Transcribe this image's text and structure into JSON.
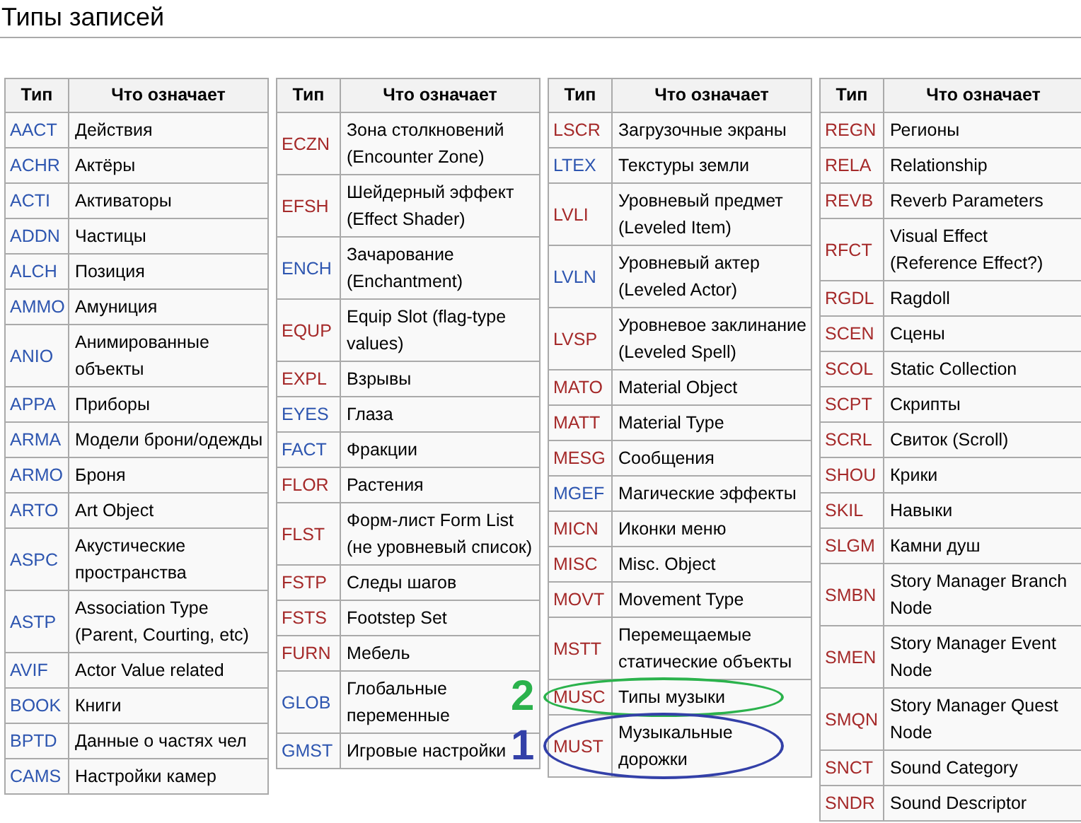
{
  "title": "Типы записей",
  "tables": [
    {
      "columns": [
        "Тип",
        "Что означает"
      ],
      "rows": [
        {
          "code": "AACT",
          "missing": false,
          "meaning": "Действия"
        },
        {
          "code": "ACHR",
          "missing": false,
          "meaning": "Актёры"
        },
        {
          "code": "ACTI",
          "missing": false,
          "meaning": "Активаторы"
        },
        {
          "code": "ADDN",
          "missing": false,
          "meaning": "Частицы"
        },
        {
          "code": "ALCH",
          "missing": false,
          "meaning": "Позиция"
        },
        {
          "code": "AMMO",
          "missing": false,
          "meaning": "Амуниция"
        },
        {
          "code": "ANIO",
          "missing": false,
          "meaning": "Анимированные объекты"
        },
        {
          "code": "APPA",
          "missing": false,
          "meaning": "Приборы"
        },
        {
          "code": "ARMA",
          "missing": false,
          "meaning": "Модели брони/одежды"
        },
        {
          "code": "ARMO",
          "missing": false,
          "meaning": "Броня"
        },
        {
          "code": "ARTO",
          "missing": false,
          "meaning": "Art Object"
        },
        {
          "code": "ASPC",
          "missing": false,
          "meaning": "Акустические пространства"
        },
        {
          "code": "ASTP",
          "missing": false,
          "meaning": "Association Type (Parent, Courting, etc)"
        },
        {
          "code": "AVIF",
          "missing": false,
          "meaning": "Actor Value related"
        },
        {
          "code": "BOOK",
          "missing": false,
          "meaning": "Книги"
        },
        {
          "code": "BPTD",
          "missing": false,
          "meaning": "Данные о частях чел"
        },
        {
          "code": "CAMS",
          "missing": false,
          "meaning": "Настройки камер"
        }
      ]
    },
    {
      "columns": [
        "Тип",
        "Что означает"
      ],
      "rows": [
        {
          "code": "ECZN",
          "missing": true,
          "meaning": "Зона столкновений (Encounter Zone)"
        },
        {
          "code": "EFSH",
          "missing": true,
          "meaning": "Шейдерный эффект (Effect Shader)"
        },
        {
          "code": "ENCH",
          "missing": false,
          "meaning": "Зачарование (Enchantment)"
        },
        {
          "code": "EQUP",
          "missing": true,
          "meaning": "Equip Slot (flag-type values)"
        },
        {
          "code": "EXPL",
          "missing": true,
          "meaning": "Взрывы"
        },
        {
          "code": "EYES",
          "missing": false,
          "meaning": "Глаза"
        },
        {
          "code": "FACT",
          "missing": false,
          "meaning": "Фракции"
        },
        {
          "code": "FLOR",
          "missing": true,
          "meaning": "Растения"
        },
        {
          "code": "FLST",
          "missing": true,
          "meaning": "Форм-лист Form List (не уровневый список)"
        },
        {
          "code": "FSTP",
          "missing": true,
          "meaning": "Следы шагов"
        },
        {
          "code": "FSTS",
          "missing": true,
          "meaning": "Footstep Set"
        },
        {
          "code": "FURN",
          "missing": true,
          "meaning": "Мебель"
        },
        {
          "code": "GLOB",
          "missing": false,
          "meaning": "Глобальные переменные"
        },
        {
          "code": "GMST",
          "missing": false,
          "meaning": "Игровые настройки"
        }
      ]
    },
    {
      "columns": [
        "Тип",
        "Что означает"
      ],
      "rows": [
        {
          "code": "LSCR",
          "missing": true,
          "meaning": "Загрузочные экраны"
        },
        {
          "code": "LTEX",
          "missing": false,
          "meaning": "Текстуры земли"
        },
        {
          "code": "LVLI",
          "missing": true,
          "meaning": "Уровневый предмет (Leveled Item)"
        },
        {
          "code": "LVLN",
          "missing": false,
          "meaning": "Уровневый актер (Leveled Actor)"
        },
        {
          "code": "LVSP",
          "missing": true,
          "meaning": "Уровневое заклинание (Leveled Spell)"
        },
        {
          "code": "MATO",
          "missing": true,
          "meaning": "Material Object"
        },
        {
          "code": "MATT",
          "missing": true,
          "meaning": "Material Type"
        },
        {
          "code": "MESG",
          "missing": true,
          "meaning": "Сообщения"
        },
        {
          "code": "MGEF",
          "missing": false,
          "meaning": "Магические эффекты"
        },
        {
          "code": "MICN",
          "missing": true,
          "meaning": "Иконки меню"
        },
        {
          "code": "MISC",
          "missing": true,
          "meaning": "Misc. Object"
        },
        {
          "code": "MOVT",
          "missing": true,
          "meaning": "Movement Type"
        },
        {
          "code": "MSTT",
          "missing": true,
          "meaning": "Перемещаемые статические объекты"
        },
        {
          "code": "MUSC",
          "missing": true,
          "meaning": "Типы музыки",
          "annotation": {
            "label": "2",
            "color": "#2bb24c"
          }
        },
        {
          "code": "MUST",
          "missing": true,
          "meaning": "Музыкальные дорожки",
          "annotation": {
            "label": "1",
            "color": "#3340a8"
          }
        }
      ]
    },
    {
      "columns": [
        "Тип",
        "Что означает"
      ],
      "rows": [
        {
          "code": "REGN",
          "missing": true,
          "meaning": "Регионы"
        },
        {
          "code": "RELA",
          "missing": true,
          "meaning": "Relationship"
        },
        {
          "code": "REVB",
          "missing": true,
          "meaning": "Reverb Parameters"
        },
        {
          "code": "RFCT",
          "missing": true,
          "meaning": "Visual Effect (Reference Effect?)"
        },
        {
          "code": "RGDL",
          "missing": true,
          "meaning": "Ragdoll"
        },
        {
          "code": "SCEN",
          "missing": true,
          "meaning": "Сцены"
        },
        {
          "code": "SCOL",
          "missing": true,
          "meaning": "Static Collection"
        },
        {
          "code": "SCPT",
          "missing": true,
          "meaning": "Скрипты"
        },
        {
          "code": "SCRL",
          "missing": true,
          "meaning": "Свиток (Scroll)"
        },
        {
          "code": "SHOU",
          "missing": true,
          "meaning": "Крики"
        },
        {
          "code": "SKIL",
          "missing": true,
          "meaning": "Навыки"
        },
        {
          "code": "SLGM",
          "missing": true,
          "meaning": "Камни душ"
        },
        {
          "code": "SMBN",
          "missing": true,
          "meaning": "Story Manager Branch Node"
        },
        {
          "code": "SMEN",
          "missing": true,
          "meaning": "Story Manager Event Node"
        },
        {
          "code": "SMQN",
          "missing": true,
          "meaning": "Story Manager Quest Node"
        },
        {
          "code": "SNCT",
          "missing": true,
          "meaning": "Sound Category"
        },
        {
          "code": "SNDR",
          "missing": true,
          "meaning": "Sound Descriptor"
        }
      ]
    }
  ]
}
